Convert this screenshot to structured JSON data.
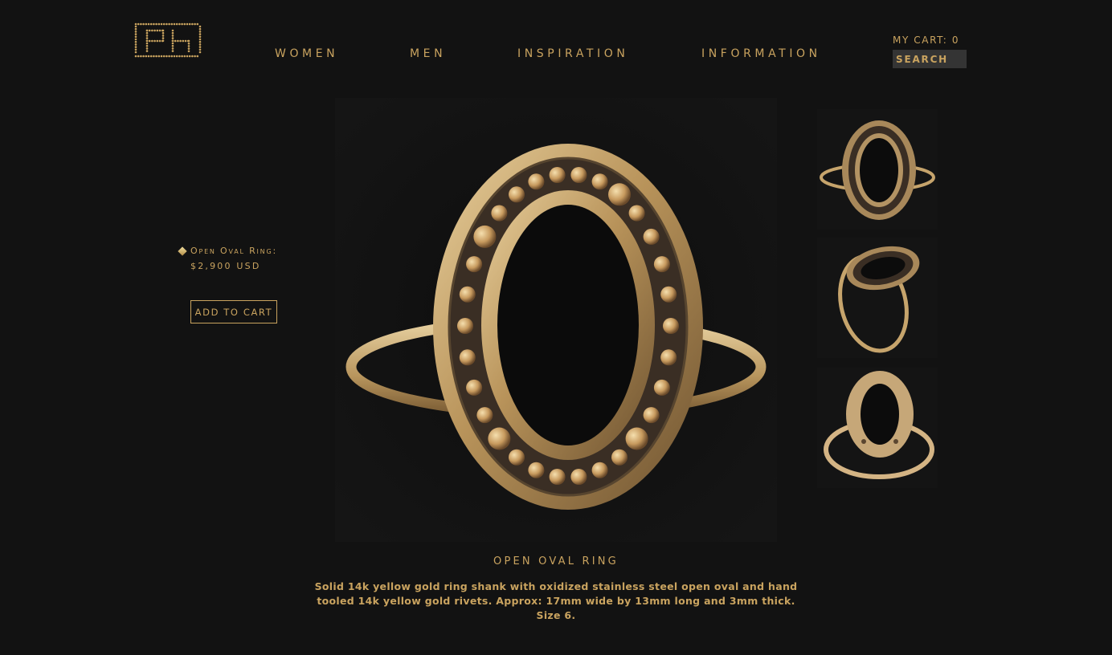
{
  "header": {
    "logo_text": "PH",
    "nav": [
      {
        "label": "WOMEN"
      },
      {
        "label": "MEN"
      },
      {
        "label": "INSPIRATION"
      },
      {
        "label": "INFORMATION"
      }
    ],
    "cart_label": "MY CART: 0",
    "search_placeholder": "SEARCH"
  },
  "product": {
    "name": "Open Oval Ring:",
    "price": "$2,900 USD",
    "add_to_cart_label": "ADD TO CART",
    "title": "OPEN OVAL RING",
    "description": "Solid 14k yellow gold ring shank with oxidized stainless steel open oval and hand tooled 14k yellow gold rivets.  Approx: 17mm wide by 13mm long and 3mm  thick.  Size 6."
  },
  "colors": {
    "background": "#121212",
    "gold_text": "#c9a35f",
    "search_bg": "#343434"
  },
  "icons": [
    "ph-logo",
    "diamond-bullet-icon"
  ]
}
